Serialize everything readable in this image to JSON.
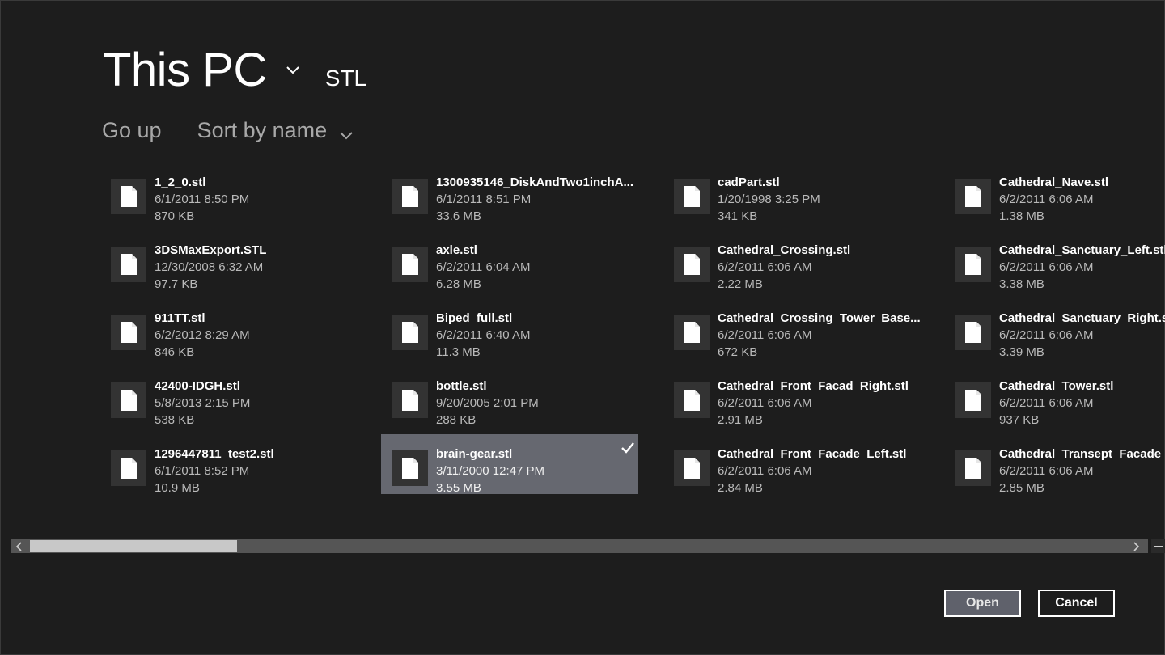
{
  "header": {
    "location_title": "This PC",
    "folder_name": "STL",
    "go_up_label": "Go up",
    "sort_label": "Sort by name"
  },
  "files": [
    [
      {
        "name": "1_2_0.stl",
        "date": "6/1/2011 8:50 PM",
        "size": "870 KB"
      },
      {
        "name": "3DSMaxExport.STL",
        "date": "12/30/2008 6:32 AM",
        "size": "97.7 KB"
      },
      {
        "name": "911TT.stl",
        "date": "6/2/2012 8:29 AM",
        "size": "846 KB"
      },
      {
        "name": "42400-IDGH.stl",
        "date": "5/8/2013 2:15 PM",
        "size": "538 KB"
      },
      {
        "name": "1296447811_test2.stl",
        "date": "6/1/2011 8:52 PM",
        "size": "10.9 MB"
      }
    ],
    [
      {
        "name": "1300935146_DiskAndTwo1inchA...",
        "date": "6/1/2011 8:51 PM",
        "size": "33.6 MB"
      },
      {
        "name": "axle.stl",
        "date": "6/2/2011 6:04 AM",
        "size": "6.28 MB"
      },
      {
        "name": "Biped_full.stl",
        "date": "6/2/2011 6:40 AM",
        "size": "11.3 MB"
      },
      {
        "name": "bottle.stl",
        "date": "9/20/2005 2:01 PM",
        "size": "288 KB"
      },
      {
        "name": "brain-gear.stl",
        "date": "3/11/2000 12:47 PM",
        "size": "3.55 MB",
        "selected": true
      }
    ],
    [
      {
        "name": "cadPart.stl",
        "date": "1/20/1998 3:25 PM",
        "size": "341 KB"
      },
      {
        "name": "Cathedral_Crossing.stl",
        "date": "6/2/2011 6:06 AM",
        "size": "2.22 MB"
      },
      {
        "name": "Cathedral_Crossing_Tower_Base...",
        "date": "6/2/2011 6:06 AM",
        "size": "672 KB"
      },
      {
        "name": "Cathedral_Front_Facad_Right.stl",
        "date": "6/2/2011 6:06 AM",
        "size": "2.91 MB"
      },
      {
        "name": "Cathedral_Front_Facade_Left.stl",
        "date": "6/2/2011 6:06 AM",
        "size": "2.84 MB"
      }
    ],
    [
      {
        "name": "Cathedral_Nave.stl",
        "date": "6/2/2011 6:06 AM",
        "size": "1.38 MB"
      },
      {
        "name": "Cathedral_Sanctuary_Left.stl",
        "date": "6/2/2011 6:06 AM",
        "size": "3.38 MB"
      },
      {
        "name": "Cathedral_Sanctuary_Right.stl",
        "date": "6/2/2011 6:06 AM",
        "size": "3.39 MB"
      },
      {
        "name": "Cathedral_Tower.stl",
        "date": "6/2/2011 6:06 AM",
        "size": "937 KB"
      },
      {
        "name": "Cathedral_Transept_Facade_L",
        "date": "6/2/2011 6:06 AM",
        "size": "2.85 MB"
      }
    ]
  ],
  "scrollbar": {
    "position_fraction": 0.0,
    "visible_fraction": 0.18
  },
  "buttons": {
    "open_label": "Open",
    "cancel_label": "Cancel"
  },
  "colors": {
    "background": "#1d1d1d",
    "selected_tile": "#666870",
    "open_button": "#5f616b"
  },
  "icons": {
    "file": "file-icon",
    "check": "checkmark-icon"
  }
}
